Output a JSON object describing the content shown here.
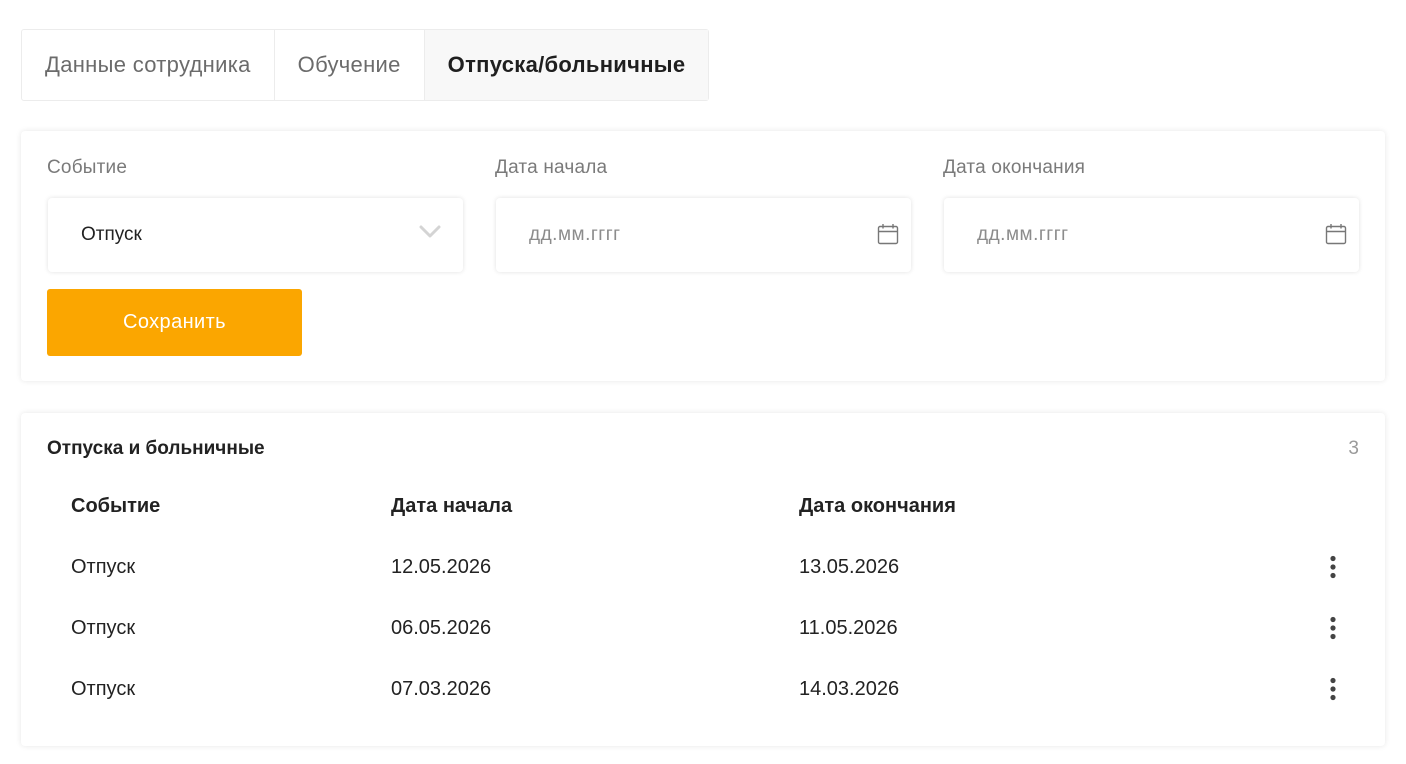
{
  "tabs": [
    {
      "label": "Данные сотрудника",
      "active": false
    },
    {
      "label": "Обучение",
      "active": false
    },
    {
      "label": "Отпуска/больничные",
      "active": true
    }
  ],
  "form": {
    "event_label": "Событие",
    "event_value": "Отпуск",
    "start_label": "Дата начала",
    "start_placeholder": "дд.мм.гггг",
    "end_label": "Дата окончания",
    "end_placeholder": "дд.мм.гггг",
    "save_label": "Сохранить",
    "accent_color": "#fba600"
  },
  "list": {
    "title": "Отпуска и больничные",
    "count": "3",
    "columns": [
      "Событие",
      "Дата начала",
      "Дата окончания"
    ],
    "rows": [
      {
        "event": "Отпуск",
        "start": "12.05.2026",
        "end": "13.05.2026"
      },
      {
        "event": "Отпуск",
        "start": "06.05.2026",
        "end": "11.05.2026"
      },
      {
        "event": "Отпуск",
        "start": "07.03.2026",
        "end": "14.03.2026"
      }
    ]
  },
  "icons": {
    "select_chevron": "chevron-down-icon",
    "date_picker": "calendar-icon",
    "row_menu": "more-vertical-icon"
  }
}
